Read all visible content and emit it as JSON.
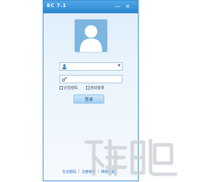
{
  "window": {
    "title": "EC 7.1",
    "minimize_symbol": "—",
    "close_symbol": "✕"
  },
  "login": {
    "username_value": "",
    "password_value": "",
    "remember_password_label": "记住密码",
    "remember_password_checked": false,
    "auto_login_label": "自动登录",
    "auto_login_checked": false,
    "login_button_label": "登录"
  },
  "footer": {
    "links": [
      "忘记密码",
      "注册帐号",
      "网络设置"
    ],
    "separator": "|"
  },
  "icons": {
    "avatar": "default-avatar-icon",
    "user": "user-icon",
    "password": "key-icon",
    "dropdown": "dropdown-arrow-icon"
  },
  "colors": {
    "titlebar": "#2b86cf",
    "window_bg": "#e6f1fb",
    "avatar_bg": "#7cb5e0",
    "button_bg": "#bfe0f8",
    "link": "#1b6fc0"
  }
}
